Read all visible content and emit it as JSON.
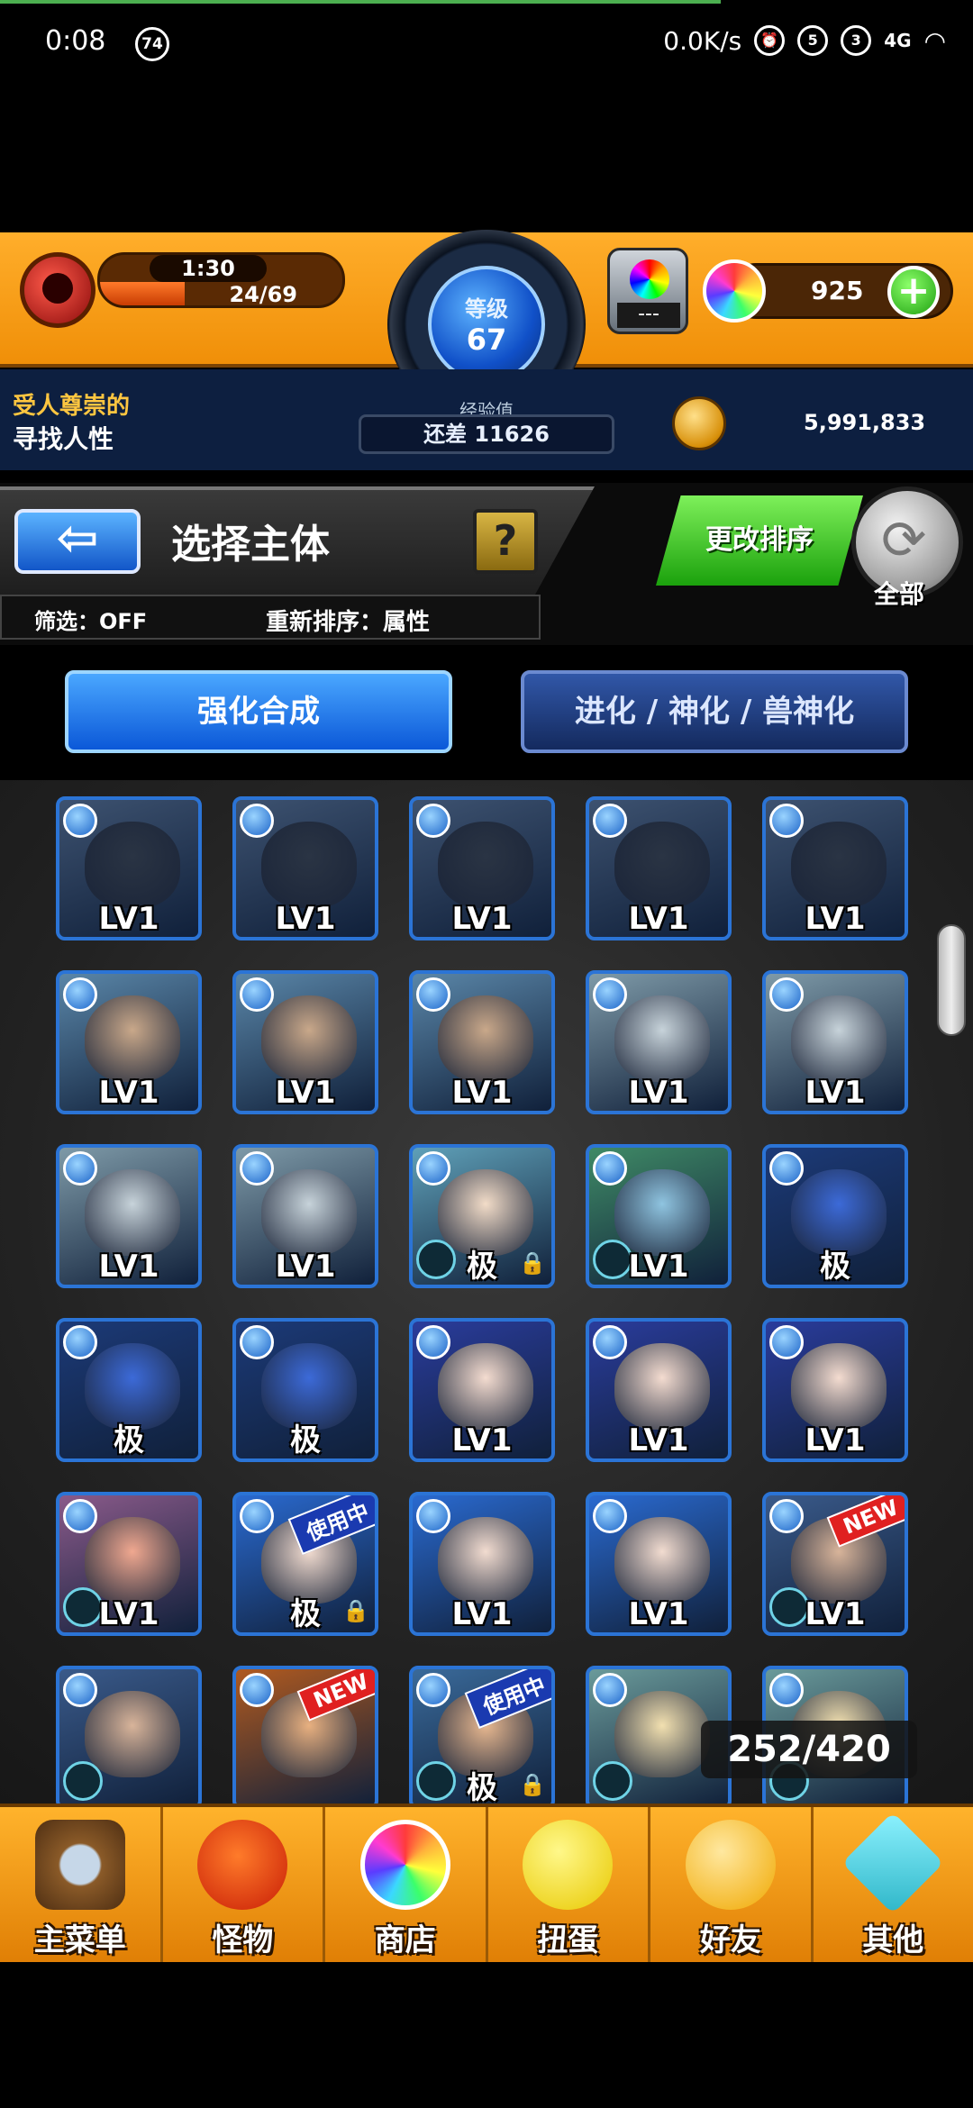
{
  "status_bar": {
    "time": "0:08",
    "notif_badge": "74",
    "speed": "0.0K/s",
    "icons": [
      "alarm-icon",
      "sim1-icon",
      "sim2-icon",
      "4g-icon",
      "wifi-icon"
    ],
    "sim1": "5",
    "sim2": "3",
    "network": "4G"
  },
  "header": {
    "stamina_timer": "1:30",
    "stamina": "24/69",
    "stamina_fraction": 0.35,
    "level_label": "等级",
    "level_value": "67",
    "gem_vial_value": "---",
    "orbs": "925",
    "orb_add": "+"
  },
  "info": {
    "title_line1": "受人尊崇的",
    "title_line2": "寻找人性",
    "exp_label": "经验值",
    "exp_remaining": "还差 11626",
    "coins": "5,991,833"
  },
  "select": {
    "back_glyph": "⇦",
    "title": "选择主体",
    "help": "?",
    "filter": "筛选：OFF",
    "sort": "重新排序：属性",
    "change_sort": "更改排序",
    "refresh_label": "全部",
    "refresh_glyph": "⟳"
  },
  "tabs": {
    "enhance": "强化合成",
    "evolve": "进化 / 神化 / 兽神化"
  },
  "grid": {
    "cells": [
      {
        "label": "LV1",
        "bg": "#3d5270",
        "face": "#2a3444",
        "ribbon": "",
        "lock": false,
        "slot": false
      },
      {
        "label": "LV1",
        "bg": "#3d5270",
        "face": "#2a3444",
        "ribbon": "",
        "lock": false,
        "slot": false
      },
      {
        "label": "LV1",
        "bg": "#3d5270",
        "face": "#2a3444",
        "ribbon": "",
        "lock": false,
        "slot": false
      },
      {
        "label": "LV1",
        "bg": "#3d5270",
        "face": "#2a3444",
        "ribbon": "",
        "lock": false,
        "slot": false
      },
      {
        "label": "LV1",
        "bg": "#3d5270",
        "face": "#2a3444",
        "ribbon": "",
        "lock": false,
        "slot": false
      },
      {
        "label": "LV1",
        "bg": "#5a86a8",
        "face": "#c9a88a",
        "ribbon": "",
        "lock": false,
        "slot": false
      },
      {
        "label": "LV1",
        "bg": "#5a86a8",
        "face": "#c9a88a",
        "ribbon": "",
        "lock": false,
        "slot": false
      },
      {
        "label": "LV1",
        "bg": "#5a86a8",
        "face": "#c9a88a",
        "ribbon": "",
        "lock": false,
        "slot": false
      },
      {
        "label": "LV1",
        "bg": "#7e9aa8",
        "face": "#c7d3da",
        "ribbon": "",
        "lock": false,
        "slot": false
      },
      {
        "label": "LV1",
        "bg": "#7e9aa8",
        "face": "#c7d3da",
        "ribbon": "",
        "lock": false,
        "slot": false
      },
      {
        "label": "LV1",
        "bg": "#7e9aa8",
        "face": "#c7d3da",
        "ribbon": "",
        "lock": false,
        "slot": false
      },
      {
        "label": "LV1",
        "bg": "#7e9aa8",
        "face": "#c7d3da",
        "ribbon": "",
        "lock": false,
        "slot": false
      },
      {
        "label": "极",
        "bg": "#5fa0b8",
        "face": "#f2dcc8",
        "ribbon": "",
        "lock": true,
        "slot": true
      },
      {
        "label": "LV1",
        "bg": "#3f8a66",
        "face": "#8fc4e0",
        "ribbon": "",
        "lock": false,
        "slot": true
      },
      {
        "label": "极",
        "bg": "#1c3a78",
        "face": "#3c6ad8",
        "ribbon": "",
        "lock": false,
        "slot": false
      },
      {
        "label": "极",
        "bg": "#1c3a78",
        "face": "#3c6ad8",
        "ribbon": "",
        "lock": false,
        "slot": false
      },
      {
        "label": "极",
        "bg": "#1c3a78",
        "face": "#3c6ad8",
        "ribbon": "",
        "lock": false,
        "slot": false
      },
      {
        "label": "LV1",
        "bg": "#2a3c9c",
        "face": "#f4dcd0",
        "ribbon": "",
        "lock": false,
        "slot": false
      },
      {
        "label": "LV1",
        "bg": "#2a3c9c",
        "face": "#f4dcd0",
        "ribbon": "",
        "lock": false,
        "slot": false
      },
      {
        "label": "LV1",
        "bg": "#2a3c9c",
        "face": "#f4dcd0",
        "ribbon": "",
        "lock": false,
        "slot": false
      },
      {
        "label": "LV1",
        "bg": "#8a5a8a",
        "face": "#f0a890",
        "ribbon": "",
        "lock": false,
        "slot": true
      },
      {
        "label": "极",
        "bg": "#2a6ad0",
        "face": "#f2dcd0",
        "ribbon": "使用中",
        "lock": true,
        "slot": false
      },
      {
        "label": "LV1",
        "bg": "#2a6ad0",
        "face": "#f2dcd0",
        "ribbon": "",
        "lock": false,
        "slot": false
      },
      {
        "label": "LV1",
        "bg": "#2a6ad0",
        "face": "#f2dcd0",
        "ribbon": "",
        "lock": false,
        "slot": false
      },
      {
        "label": "LV1",
        "bg": "#3a5a8a",
        "face": "#d8b49a",
        "ribbon": "NEW",
        "lock": false,
        "slot": true
      },
      {
        "label": "",
        "bg": "#3a5a8a",
        "face": "#d8b49a",
        "ribbon": "",
        "lock": false,
        "slot": true
      },
      {
        "label": "",
        "bg": "#b05a20",
        "face": "#e8b080",
        "ribbon": "NEW",
        "lock": false,
        "slot": false
      },
      {
        "label": "极",
        "bg": "#3a6a9a",
        "face": "#e8b890",
        "ribbon": "使用中",
        "lock": true,
        "slot": true
      },
      {
        "label": "",
        "bg": "#6a9a9a",
        "face": "#f2e0b0",
        "ribbon": "",
        "lock": false,
        "slot": true
      },
      {
        "label": "",
        "bg": "#6a9a9a",
        "face": "#f2e0b0",
        "ribbon": "",
        "lock": false,
        "slot": true
      }
    ],
    "box_count": "252/420"
  },
  "nav": {
    "home": "主菜单",
    "monster": "怪物",
    "shop": "商店",
    "gacha": "扭蛋",
    "friends": "好友",
    "other": "其他"
  },
  "colors": {
    "header_orange": "#f5a020",
    "navy": "#0d1f40",
    "accent_blue": "#2b74d6",
    "new_ribbon": "#e02020",
    "inuse_ribbon": "#1a3ab0"
  }
}
